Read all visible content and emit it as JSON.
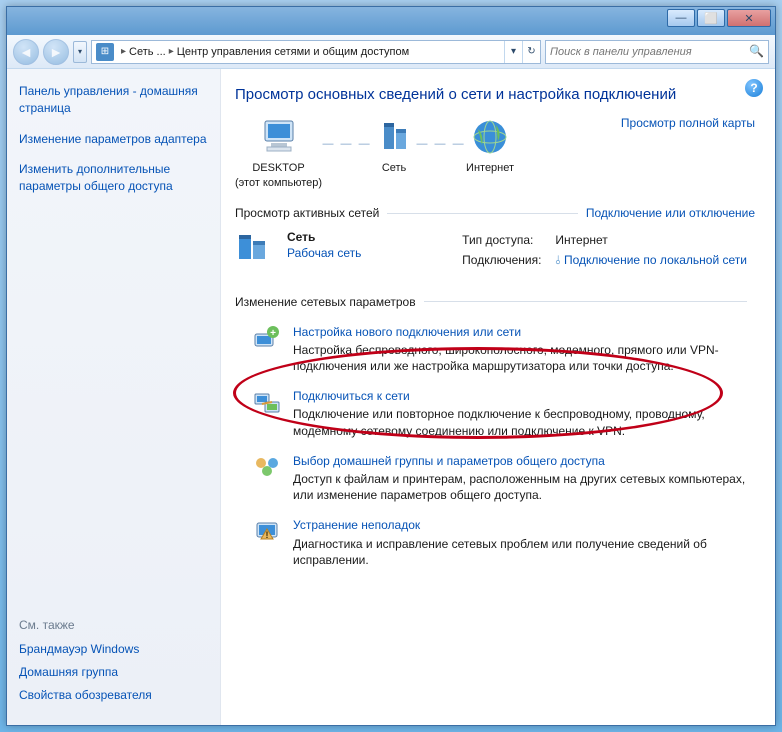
{
  "titlebar": {
    "min": "—",
    "max": "⬜",
    "close": "✕"
  },
  "nav": {
    "crumb1": "Сеть ...",
    "crumb2": "Центр управления сетями и общим доступом",
    "search_placeholder": "Поиск в панели управления"
  },
  "sidebar": {
    "nav": [
      "Панель управления - домашняя страница",
      "Изменение параметров адаптера",
      "Изменить дополнительные параметры общего доступа"
    ],
    "see_also_label": "См. также",
    "see_also": [
      "Брандмауэр Windows",
      "Домашняя группа",
      "Свойства обозревателя"
    ]
  },
  "main": {
    "heading": "Просмотр основных сведений о сети и настройка подключений",
    "map_link": "Просмотр полной карты",
    "nodes": {
      "desktop": "DESKTOP",
      "desktop_sub": "(этот компьютер)",
      "net": "Сеть",
      "internet": "Интернет"
    },
    "active_hdr": "Просмотр активных сетей",
    "active_link": "Подключение или отключение",
    "active": {
      "name": "Сеть",
      "category": "Рабочая сеть",
      "access_label": "Тип доступа:",
      "access_value": "Интернет",
      "conn_label": "Подключения:",
      "conn_value": "Подключение по локальной сети"
    },
    "change_hdr": "Изменение сетевых параметров",
    "options": [
      {
        "title": "Настройка нового подключения или сети",
        "desc": "Настройка беспроводного, широкополосного, модемного, прямого или VPN-подключения или же настройка маршрутизатора или точки доступа."
      },
      {
        "title": "Подключиться к сети",
        "desc": "Подключение или повторное подключение к беспроводному, проводному, модемному сетевому соединению или подключение к VPN."
      },
      {
        "title": "Выбор домашней группы и параметров общего доступа",
        "desc": "Доступ к файлам и принтерам, расположенным на других сетевых компьютерах, или изменение параметров общего доступа."
      },
      {
        "title": "Устранение неполадок",
        "desc": "Диагностика и исправление сетевых проблем или получение сведений об исправлении."
      }
    ]
  }
}
